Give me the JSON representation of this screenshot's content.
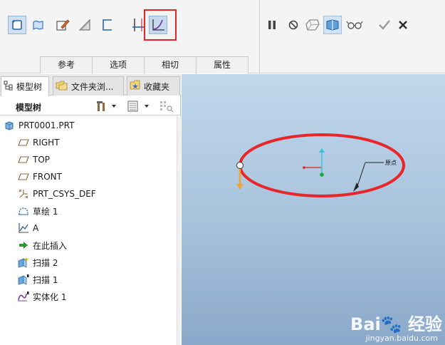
{
  "ribbon": {
    "tabs": [
      {
        "label": "参考"
      },
      {
        "label": "选项"
      },
      {
        "label": "相切"
      },
      {
        "label": "属性"
      }
    ],
    "icons": {
      "solid": "solid-extrude-icon",
      "surface": "surface-icon",
      "sketch": "sketch-edit-icon",
      "thin": "thin-feature-icon",
      "trajectory": "trajectory-icon",
      "section": "section-icon",
      "curve": "curve-graph-icon",
      "pause": "pause-icon",
      "stop": "no-preview-icon",
      "ghost": "ghost-preview-icon",
      "preview": "feature-preview-icon",
      "glasses": "verify-glasses-icon",
      "ok": "checkmark-icon",
      "cancel": "close-icon"
    },
    "highlight_color": "#e8262a"
  },
  "panel": {
    "tabs": [
      {
        "label": "模型树",
        "icon": "model-tree-icon"
      },
      {
        "label": "文件夹浏...",
        "icon": "folder-browser-icon"
      },
      {
        "label": "收藏夹",
        "icon": "favorites-icon"
      }
    ],
    "header_title": "模型树",
    "tree": [
      {
        "label": "PRT0001.PRT",
        "icon": "part-icon"
      },
      {
        "label": "RIGHT",
        "icon": "datum-plane-icon"
      },
      {
        "label": "TOP",
        "icon": "datum-plane-icon"
      },
      {
        "label": "FRONT",
        "icon": "datum-plane-icon"
      },
      {
        "label": "PRT_CSYS_DEF",
        "icon": "csys-icon"
      },
      {
        "label": "草绘 1",
        "icon": "sketch-icon"
      },
      {
        "label": "A",
        "icon": "graph-icon"
      },
      {
        "label": "在此插入",
        "icon": "insert-here-arrow-icon"
      },
      {
        "label": "扫描 2",
        "icon": "sweep-icon"
      },
      {
        "label": "扫描 1",
        "icon": "sweep-icon"
      },
      {
        "label": "实体化 1",
        "icon": "solidify-icon"
      }
    ]
  },
  "viewport": {
    "annotation_label": "原点",
    "trajectory_color": "#e8262a",
    "watermark": {
      "logo": "Bai🐾 经验",
      "sub": "jingyan.baidu.com"
    }
  }
}
